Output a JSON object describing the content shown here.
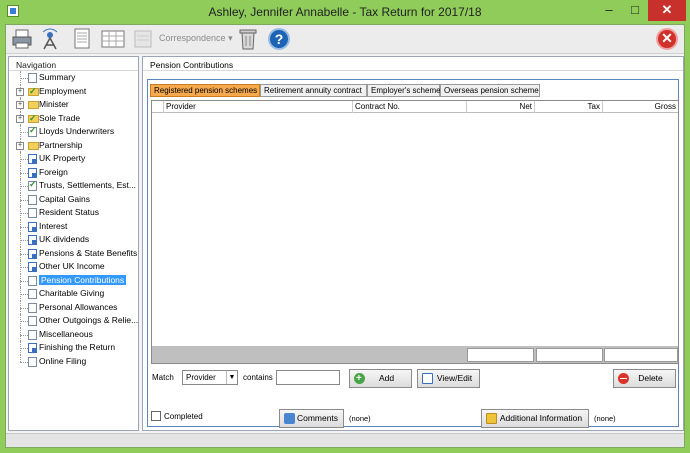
{
  "window": {
    "title": "Ashley, Jennifer Annabelle - Tax Return for 2017/18",
    "minimize_glyph": "–",
    "maximize_glyph": "□",
    "close_glyph": "✕"
  },
  "toolbar": {
    "correspondence_label": "Correspondence",
    "correspondence_arrow": "▾",
    "help_glyph": "?",
    "exit_glyph": "✕"
  },
  "navigation": {
    "title": "Navigation",
    "items": [
      {
        "label": "Summary"
      },
      {
        "label": "Employment"
      },
      {
        "label": "Minister"
      },
      {
        "label": "Sole Trade"
      },
      {
        "label": "Lloyds Underwriters"
      },
      {
        "label": "Partnership"
      },
      {
        "label": "UK Property"
      },
      {
        "label": "Foreign"
      },
      {
        "label": "Trusts, Settlements, Est..."
      },
      {
        "label": "Capital Gains"
      },
      {
        "label": "Resident Status"
      },
      {
        "label": "Interest"
      },
      {
        "label": "UK dividends"
      },
      {
        "label": "Pensions & State Benefits"
      },
      {
        "label": "Other UK Income"
      },
      {
        "label": "Pension Contributions"
      },
      {
        "label": "Charitable Giving"
      },
      {
        "label": "Personal Allowances"
      },
      {
        "label": "Other Outgoings & Relie..."
      },
      {
        "label": "Miscellaneous"
      },
      {
        "label": "Finishing the Return"
      },
      {
        "label": "Online Filing"
      }
    ],
    "selected": "Pension Contributions"
  },
  "main": {
    "title": "Pension Contributions",
    "tabs": [
      {
        "label": "Registered pension schemes",
        "active": true
      },
      {
        "label": "Retirement annuity contract",
        "active": false
      },
      {
        "label": "Employer's scheme",
        "active": false
      },
      {
        "label": "Overseas pension scheme",
        "active": false
      }
    ],
    "table": {
      "columns": [
        "Provider",
        "Contract No.",
        "Net",
        "Tax",
        "Gross"
      ],
      "rows": []
    },
    "match_label": "Match",
    "match_value": "Provider",
    "contains_label": "contains",
    "contains_value": "",
    "add_label": "Add",
    "view_edit_label": "View/Edit",
    "delete_label": "Delete",
    "completed_label": "Completed",
    "comments_label": "Comments",
    "comments_value": "(none)",
    "additional_info_label": "Additional Information",
    "additional_info_value": "(none)"
  },
  "colors": {
    "window_frame": "#8fcc5a",
    "active_tab": "#f6a94d",
    "selection": "#3399ff",
    "close_button": "#c7302b"
  }
}
